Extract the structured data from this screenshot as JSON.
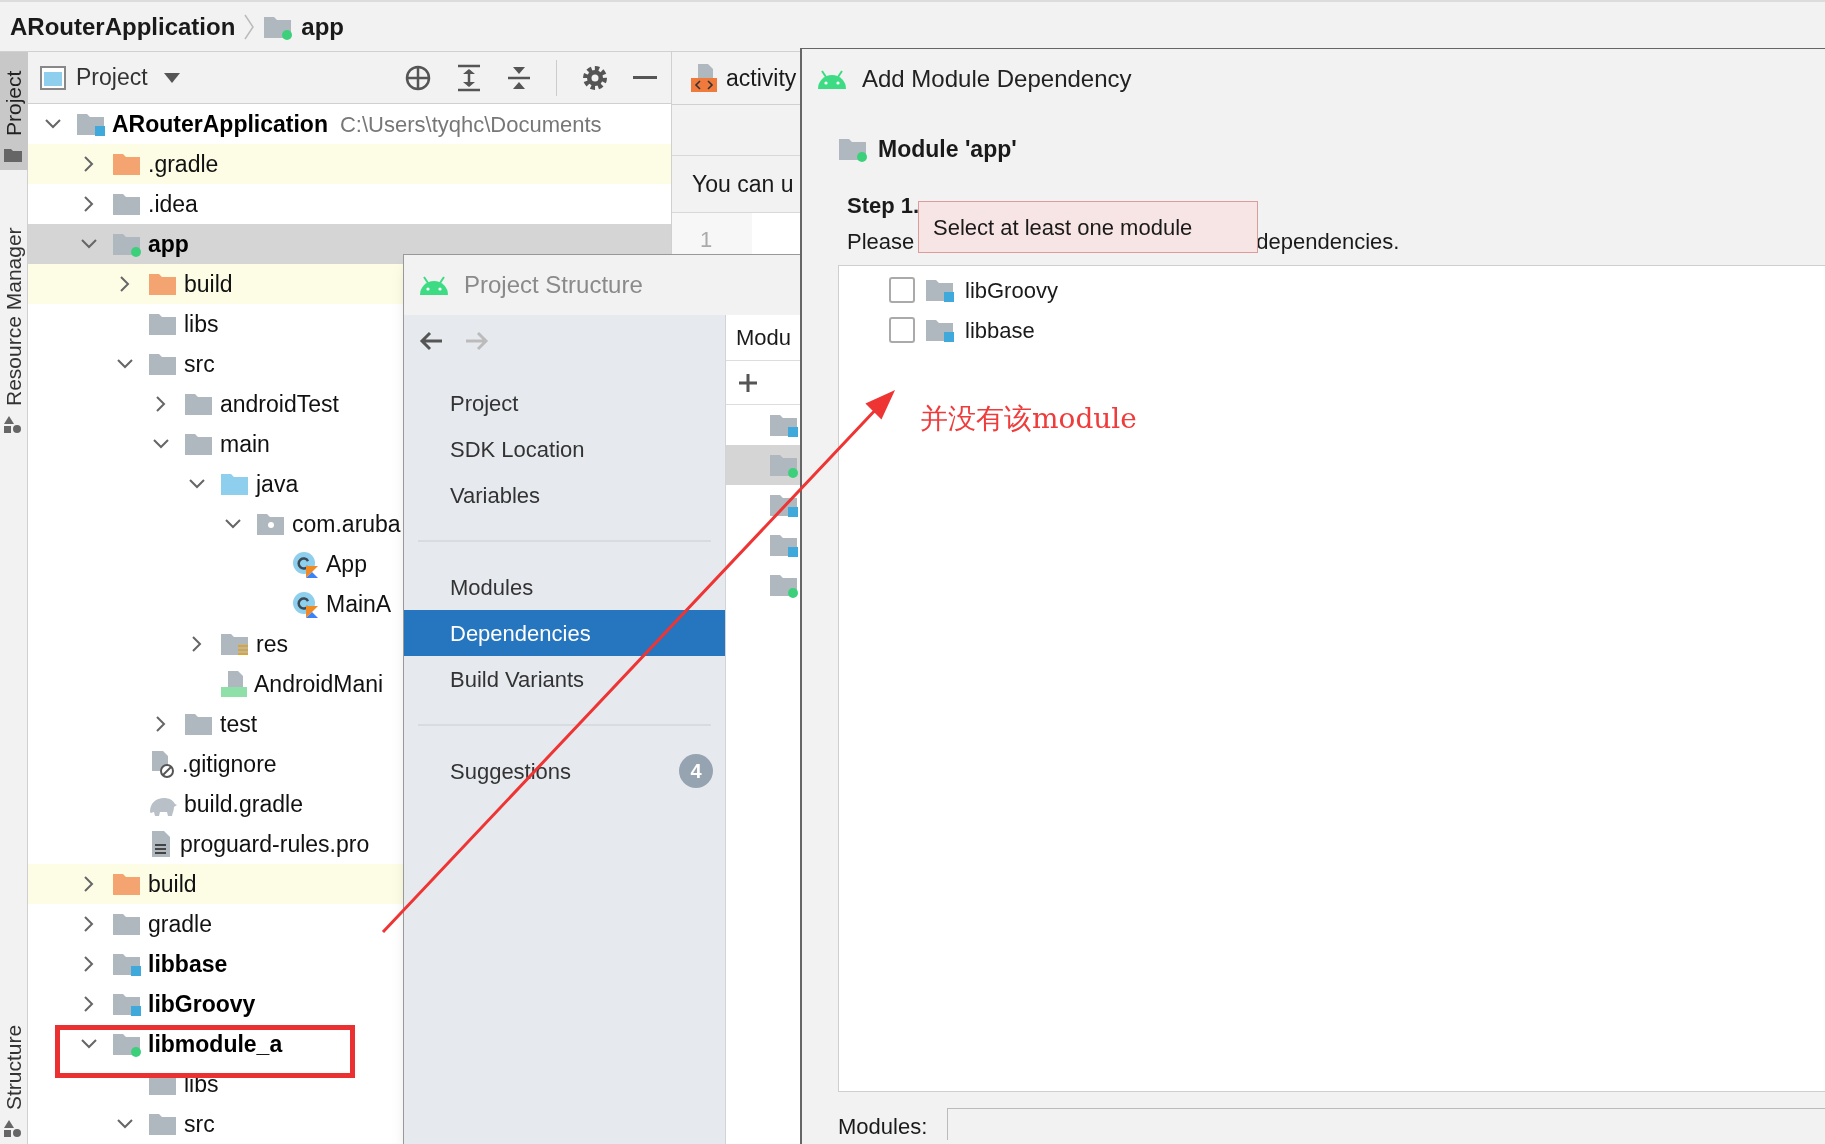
{
  "breadcrumb": [
    {
      "text": "ARouterApplication",
      "kind": "project"
    },
    {
      "text": "app",
      "kind": "app_module"
    }
  ],
  "side_tabs": [
    {
      "label": "Project",
      "selected": true
    },
    {
      "label": "Resource Manager",
      "selected": false
    },
    {
      "label": "Structure",
      "selected": false
    }
  ],
  "project_panel": {
    "view": "Project",
    "tree": [
      {
        "name": "ARouterApplication",
        "path": "C:\\Users\\tyqhc\\Documents",
        "kind": "project",
        "selected": false,
        "expanded": true,
        "children": [
          {
            "name": ".gradle",
            "kind": "excluded",
            "selected": false,
            "expanded": false
          },
          {
            "name": ".idea",
            "kind": "folder",
            "selected": false,
            "expanded": false
          },
          {
            "name": "app",
            "kind": "app_module",
            "selected": true,
            "expanded": true,
            "children": [
              {
                "name": "build",
                "kind": "excluded",
                "selected": false,
                "expanded": false
              },
              {
                "name": "libs",
                "kind": "folder",
                "selected": false
              },
              {
                "name": "src",
                "kind": "folder",
                "selected": false,
                "expanded": true,
                "children": [
                  {
                    "name": "androidTest",
                    "kind": "folder",
                    "selected": false,
                    "expanded": false
                  },
                  {
                    "name": "main",
                    "kind": "folder",
                    "selected": false,
                    "expanded": true,
                    "children": [
                      {
                        "name": "java",
                        "kind": "source",
                        "selected": false,
                        "expanded": true,
                        "children": [
                          {
                            "name": "com.aruba",
                            "kind": "package",
                            "selected": false,
                            "expanded": true,
                            "children": [
                              {
                                "name": "App",
                                "kind": "kotlin_class",
                                "selected": false
                              },
                              {
                                "name": "MainA",
                                "kind": "kotlin_class",
                                "selected": false
                              }
                            ]
                          }
                        ]
                      },
                      {
                        "name": "res",
                        "kind": "res",
                        "selected": false,
                        "expanded": false
                      },
                      {
                        "name": "AndroidMani",
                        "kind": "manifest",
                        "selected": false
                      }
                    ]
                  },
                  {
                    "name": "test",
                    "kind": "folder",
                    "selected": false,
                    "expanded": false
                  }
                ]
              },
              {
                "name": ".gitignore",
                "kind": "ignore",
                "selected": false
              },
              {
                "name": "build.gradle",
                "kind": "gradle",
                "selected": false
              },
              {
                "name": "proguard-rules.pro",
                "kind": "text",
                "selected": false
              }
            ]
          },
          {
            "name": "build",
            "kind": "excluded",
            "selected": false,
            "expanded": false
          },
          {
            "name": "gradle",
            "kind": "folder",
            "selected": false,
            "expanded": false
          },
          {
            "name": "libbase",
            "kind": "library",
            "selected": false,
            "expanded": false
          },
          {
            "name": "libGroovy",
            "kind": "library",
            "selected": false,
            "expanded": false
          },
          {
            "name": "libmodule_a",
            "kind": "app_module",
            "selected": false,
            "expanded": true,
            "children": [
              {
                "name": "libs",
                "kind": "folder",
                "selected": false
              },
              {
                "name": "src",
                "kind": "folder",
                "selected": false,
                "expanded": true
              }
            ]
          }
        ]
      }
    ]
  },
  "editor": {
    "tab": "activity",
    "notice": "You can u",
    "line_number": "1"
  },
  "project_structure": {
    "title": "Project Structure",
    "nav_buttons": [
      {
        "kind": "back",
        "disabled": false
      },
      {
        "kind": "forward",
        "disabled": true
      }
    ],
    "nav_groups": [
      [
        {
          "label": "Project",
          "selected": false
        },
        {
          "label": "SDK Location",
          "selected": false
        },
        {
          "label": "Variables",
          "selected": false
        }
      ],
      [
        {
          "label": "Modules",
          "selected": false
        },
        {
          "label": "Dependencies",
          "selected": true
        },
        {
          "label": "Build Variants",
          "selected": false
        }
      ],
      [
        {
          "label": "Suggestions",
          "selected": false,
          "badge": "4"
        }
      ]
    ],
    "panel_header": "Modu",
    "modules": [
      {
        "kind": "project",
        "selected": false
      },
      {
        "kind": "app_module",
        "selected": true
      },
      {
        "kind": "library",
        "selected": false
      },
      {
        "kind": "library",
        "selected": false
      },
      {
        "kind": "app_module",
        "selected": false
      }
    ]
  },
  "dialog": {
    "title": "Add Module Dependency",
    "module": "Module 'app'",
    "step": "Step 1.",
    "instruction_start": "Please",
    "instruction_end": "dependencies.",
    "tooltip": "Select at least one module",
    "modules": [
      {
        "name": "libGroovy",
        "kind": "library",
        "checked": false
      },
      {
        "name": "libbase",
        "kind": "library",
        "checked": false
      }
    ],
    "modules_label": "Modules:"
  },
  "annotation": {
    "text": "并没有该module"
  }
}
